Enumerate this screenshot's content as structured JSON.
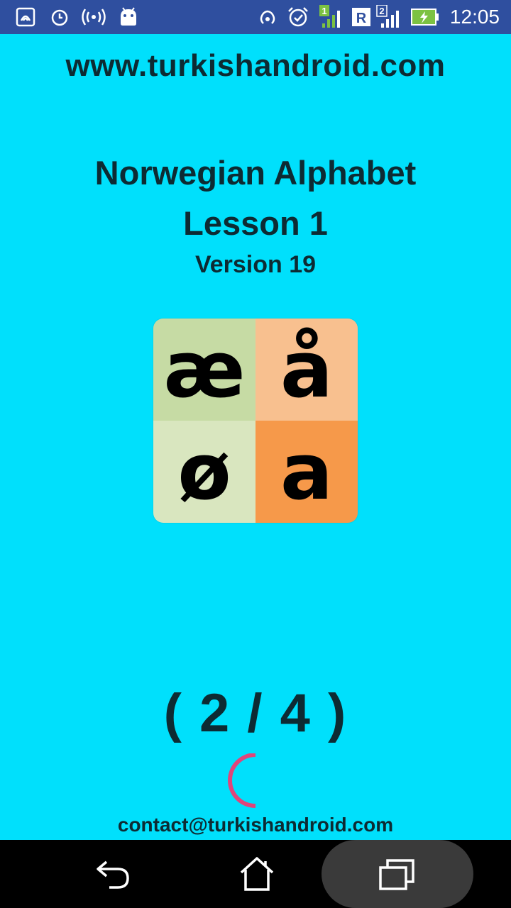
{
  "status_bar": {
    "time": "12:05",
    "left_icons": [
      "nfc-icon",
      "alarm-icon",
      "wireless-broadcast-icon",
      "android-icon"
    ],
    "right_icons": [
      "hotspot-icon",
      "alarm-clock-icon",
      "sim1-signal-icon",
      "sim2-signal-icon",
      "battery-charging-icon"
    ],
    "sim1_label": "1",
    "sim2_label": "2",
    "roaming_label": "R"
  },
  "header": {
    "url": "www.turkishandroid.com"
  },
  "main": {
    "title_line1": "Norwegian Alphabet",
    "title_line2": "Lesson 1",
    "version": "Version 19",
    "logo_letters": [
      "æ",
      "å",
      "ø",
      "a"
    ],
    "logo_colors": [
      "#c6dba4",
      "#f8c08f",
      "#d9e6bf",
      "#f6994a"
    ],
    "counter": "( 2 / 4 )",
    "contact": "contact@turkishandroid.com"
  },
  "nav_bar": {
    "buttons": [
      "back-icon",
      "home-icon",
      "recents-icon"
    ]
  },
  "colors": {
    "background": "#00e0fc",
    "status_bar": "#2f4f9f",
    "spinner": "#e0457b",
    "text": "#0d2b33"
  }
}
